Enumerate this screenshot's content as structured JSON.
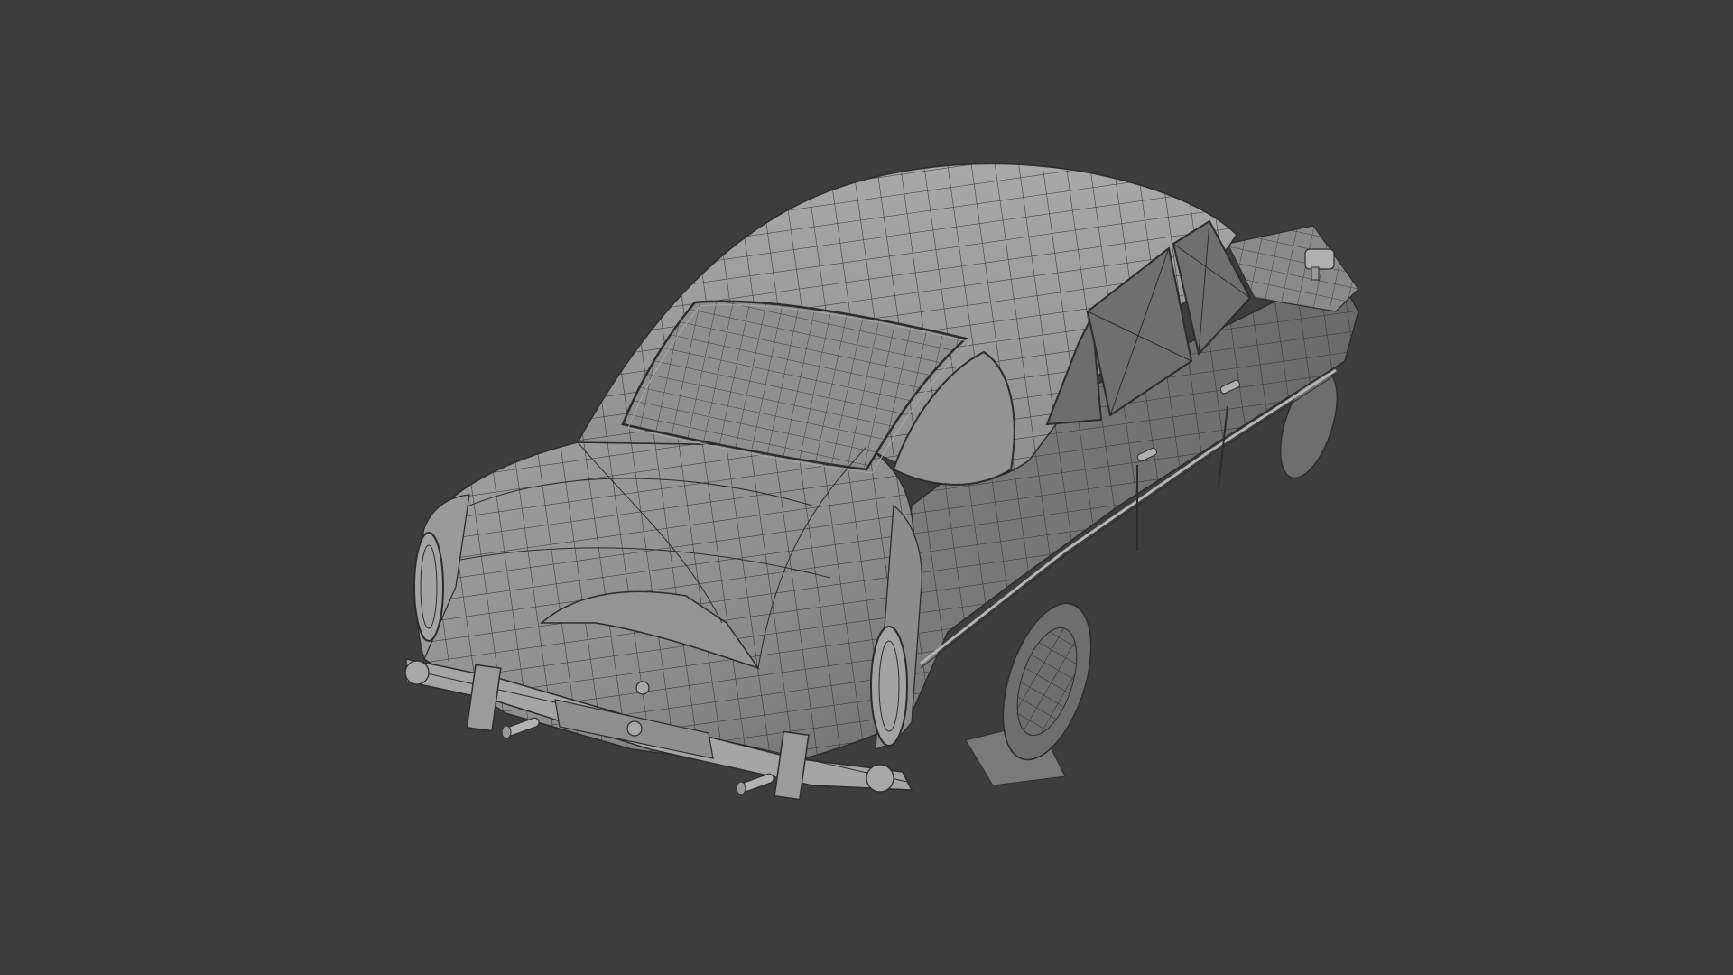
{
  "viewport": {
    "background_color": "#3d3d3d",
    "mesh_fill_color": "#8a8a8a",
    "mesh_wire_color": "#2c2c2c",
    "mesh_highlight_color": "#a2a2a2"
  },
  "scene": {
    "object": "car-mesh",
    "display": "solid-with-wireframe"
  }
}
